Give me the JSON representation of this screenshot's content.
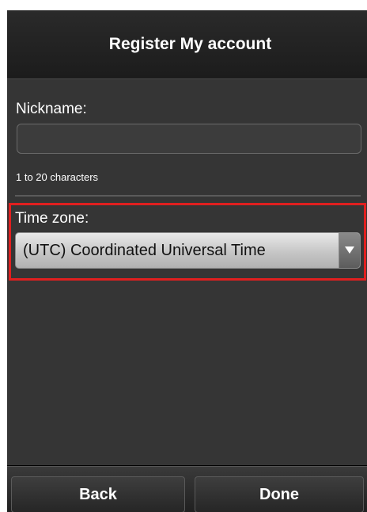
{
  "header": {
    "title": "Register My account"
  },
  "form": {
    "nickname_label": "Nickname:",
    "nickname_value": "",
    "nickname_hint": "1 to 20 characters",
    "timezone_label": "Time zone:",
    "timezone_value": "(UTC) Coordinated Universal Time"
  },
  "footer": {
    "back_label": "Back",
    "done_label": "Done"
  },
  "colors": {
    "highlight": "#e01f1f",
    "background": "#353535"
  },
  "icons": {
    "timezone_dropdown": "triangle-down-icon"
  }
}
